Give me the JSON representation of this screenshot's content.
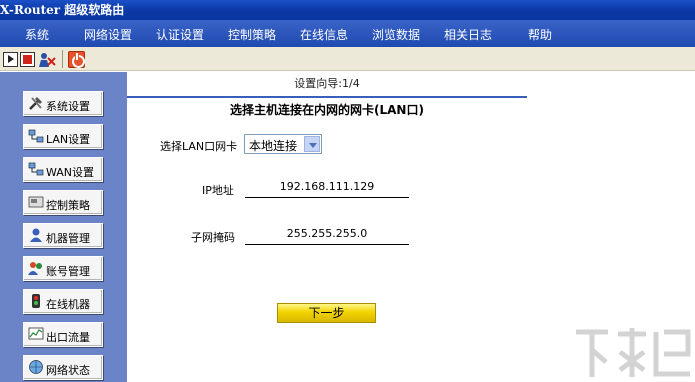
{
  "app": {
    "title": "X-Router 超级软路由"
  },
  "menu": [
    "系统",
    "网络设置",
    "认证设置",
    "控制策略",
    "在线信息",
    "浏览数据",
    "相关日志",
    "帮助"
  ],
  "toolbar": {
    "icons": [
      "play-icon",
      "stop-icon",
      "user-icon",
      "power-icon"
    ]
  },
  "sidebar": {
    "items": [
      {
        "label": "系统设置",
        "icon": "tools-icon"
      },
      {
        "label": "LAN设置",
        "icon": "lan-icon"
      },
      {
        "label": "WAN设置",
        "icon": "wan-icon"
      },
      {
        "label": "控制策略",
        "icon": "policy-icon"
      },
      {
        "label": "机器管理",
        "icon": "machine-icon"
      },
      {
        "label": "账号管理",
        "icon": "users-icon"
      },
      {
        "label": "在线机器",
        "icon": "online-icon"
      },
      {
        "label": "出口流量",
        "icon": "traffic-icon"
      },
      {
        "label": "网络状态",
        "icon": "network-status-icon"
      }
    ]
  },
  "wizard": {
    "step_title": "设置向导:1/4",
    "heading": "选择主机连接在内网的网卡(LAN口)",
    "select_label": "选择LAN口网卡",
    "select_value": "本地连接",
    "ip_label": "IP地址",
    "ip_value": "192.168.111.129",
    "mask_label": "子网掩码",
    "mask_value": "255.255.255.0",
    "next_label": "下一步"
  },
  "watermark": {
    "text": "下载吧"
  },
  "colors": {
    "title_bar": "#0a3aa6",
    "menu_bar": "#2a53b8",
    "sidebar": "#6b84c8",
    "divider": "#3a5fb8",
    "next_button": "#f2d400"
  }
}
